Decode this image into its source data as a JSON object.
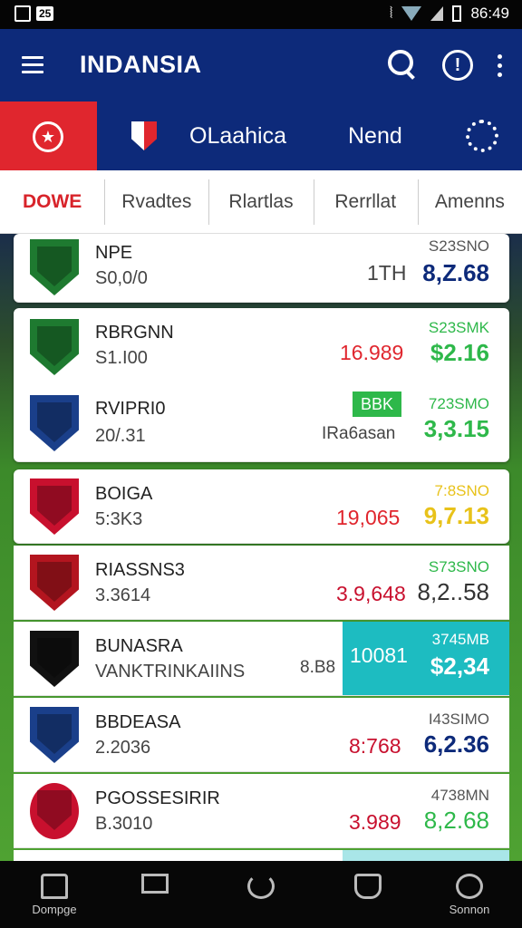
{
  "status_bar": {
    "left_badge": "25",
    "time": "86:49"
  },
  "app_bar": {
    "title": "INDANSIA"
  },
  "tournament_bar": {
    "title": "OLaahica",
    "next_label": "Nend"
  },
  "tabs": [
    {
      "label": "DOWE",
      "active": true
    },
    {
      "label": "Rvadtes",
      "active": false
    },
    {
      "label": "Rlartlas",
      "active": false
    },
    {
      "label": "Rerrllat",
      "active": false
    },
    {
      "label": "Amenns",
      "active": false
    }
  ],
  "rows": [
    {
      "name": "NPE",
      "sub": "S0,0/0",
      "mid": "1TH",
      "mid_color": "#444",
      "right_small": "S23SNO",
      "right_small_color": "#555",
      "right_big": "8,Z.68",
      "right_big_color": "#0d2a7a",
      "crest_color": "#1e7a30"
    },
    {
      "name": "RBRGNN",
      "sub": "S1.I00",
      "mid": "16.989",
      "mid_color": "#e0262e",
      "right_small": "S23SMK",
      "right_small_color": "#2eb84a",
      "right_big": "$2.16",
      "right_big_color": "#2eb84a",
      "crest_color": "#1e7a30"
    },
    {
      "name": "RVIPRI0",
      "sub": "20/.31",
      "pill": "BBK",
      "mid": "IRa6asan",
      "mid_color": "#444",
      "right_small": "723SMO",
      "right_small_color": "#2eb84a",
      "right_big": "3,3.15",
      "right_big_color": "#2eb84a",
      "crest_color": "#1a3f8a"
    },
    {
      "name": "BOIGA",
      "sub": "5:3K3",
      "mid": "19,065",
      "mid_color": "#e0262e",
      "right_small": "7:8SNO",
      "right_small_color": "#e8c21a",
      "right_big": "9,7.13",
      "right_big_color": "#e8c21a",
      "crest_color": "#c8102e"
    },
    {
      "name": "RIASSNS3",
      "sub": "3.3614",
      "mid": "3.9,648",
      "mid_color": "#c8102e",
      "right_small": "S73SNO",
      "right_small_color": "#2eb84a",
      "right_big": "8,2..58",
      "right_big_color": "#333",
      "crest_color": "#b3151f"
    },
    {
      "name": "BUNASRA",
      "sub": "VANKTRINKAIINS",
      "mid": "8.B8",
      "mid_color": "#444",
      "teal": "10081",
      "right_small": "3745MB",
      "right_small_color": "#ffffff",
      "right_big": "$2,34",
      "right_big_color": "#ffffff",
      "crest_color": "#111111"
    },
    {
      "name": "BBDEASA",
      "sub": "2.2036",
      "mid": "8:768",
      "mid_color": "#c8102e",
      "right_small": "I43SIMO",
      "right_small_color": "#555",
      "right_big": "6,2.36",
      "right_big_color": "#0d2a7a",
      "crest_color": "#1a3f8a"
    },
    {
      "name": "PGOSSESIRIR",
      "sub": "B.3010",
      "mid": "3.989",
      "mid_color": "#c8102e",
      "right_small": "4738MN",
      "right_small_color": "#555",
      "right_big": "8,2.68",
      "right_big_color": "#2eb84a",
      "crest_color": "#c8102e"
    }
  ],
  "nav": [
    {
      "label": "Dompge",
      "icon": "home-icon"
    },
    {
      "label": "",
      "icon": "square-icon"
    },
    {
      "label": "",
      "icon": "refresh-icon"
    },
    {
      "label": "",
      "icon": "shield-icon"
    },
    {
      "label": "Sonnon",
      "icon": "soccer-ball-icon"
    }
  ]
}
